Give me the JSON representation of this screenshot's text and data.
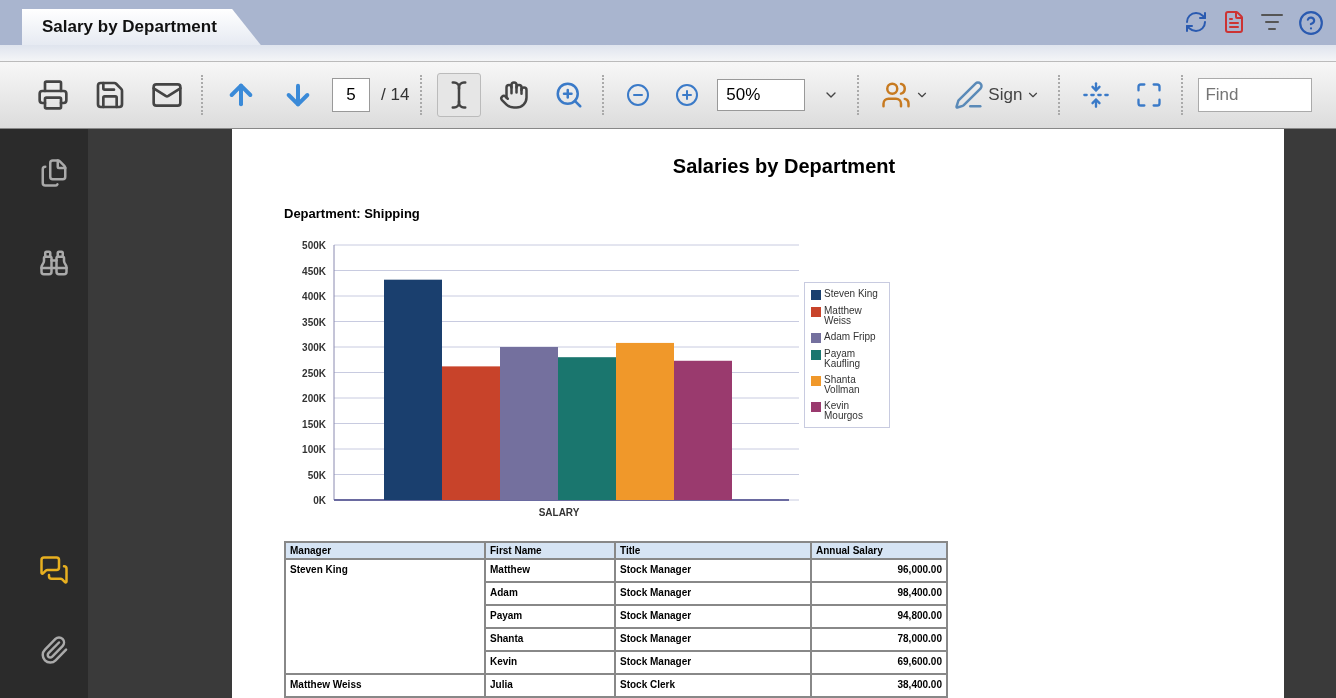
{
  "tab": {
    "label": "Salary by Department",
    "selected": true
  },
  "toolbar": {
    "page": "5",
    "page_total": "/ 14",
    "zoom": "50%",
    "sign": "Sign",
    "find_placeholder": "Find",
    "select_tool_active": true
  },
  "document": {
    "title": "Salaries by Department",
    "subtitle": "Department: Shipping",
    "chart_data": {
      "type": "bar",
      "categories": [
        "SALARY"
      ],
      "ylim": [
        0,
        500000
      ],
      "grid": true,
      "legend": "right",
      "yticks": [
        {
          "value": 0,
          "label": "0K"
        },
        {
          "value": 50000,
          "label": "50K"
        },
        {
          "value": 100000,
          "label": "100K"
        },
        {
          "value": 150000,
          "label": "150K"
        },
        {
          "value": 200000,
          "label": "200K"
        },
        {
          "value": 250000,
          "label": "250K"
        },
        {
          "value": 300000,
          "label": "300K"
        },
        {
          "value": 350000,
          "label": "350K"
        },
        {
          "value": 400000,
          "label": "400K"
        },
        {
          "value": 450000,
          "label": "450K"
        },
        {
          "value": 500000,
          "label": "500K"
        }
      ],
      "series": [
        {
          "name": "Steven King",
          "color": "#1a3f6e",
          "values": [
            432000
          ]
        },
        {
          "name": "Matthew Weiss",
          "color": "#c8432a",
          "values": [
            262000
          ]
        },
        {
          "name": "Adam Fripp",
          "color": "#74709e",
          "values": [
            300000
          ]
        },
        {
          "name": "Payam Kaufling",
          "color": "#1a766e",
          "values": [
            280000
          ]
        },
        {
          "name": "Shanta Vollman",
          "color": "#f0982a",
          "values": [
            308000
          ]
        },
        {
          "name": "Kevin Mourgos",
          "color": "#9a3a6e",
          "values": [
            273000
          ]
        }
      ]
    },
    "table": {
      "columns": [
        "Manager",
        "First Name",
        "Title",
        "Annual Salary"
      ],
      "groups": [
        {
          "manager": "Steven King",
          "rows": [
            [
              "Matthew",
              "Stock Manager",
              "96,000.00"
            ],
            [
              "Adam",
              "Stock Manager",
              "98,400.00"
            ],
            [
              "Payam",
              "Stock Manager",
              "94,800.00"
            ],
            [
              "Shanta",
              "Stock Manager",
              "78,000.00"
            ],
            [
              "Kevin",
              "Stock Manager",
              "69,600.00"
            ]
          ]
        },
        {
          "manager": "Matthew Weiss",
          "rows": [
            [
              "Julia",
              "Stock Clerk",
              "38,400.00"
            ]
          ]
        }
      ]
    }
  }
}
